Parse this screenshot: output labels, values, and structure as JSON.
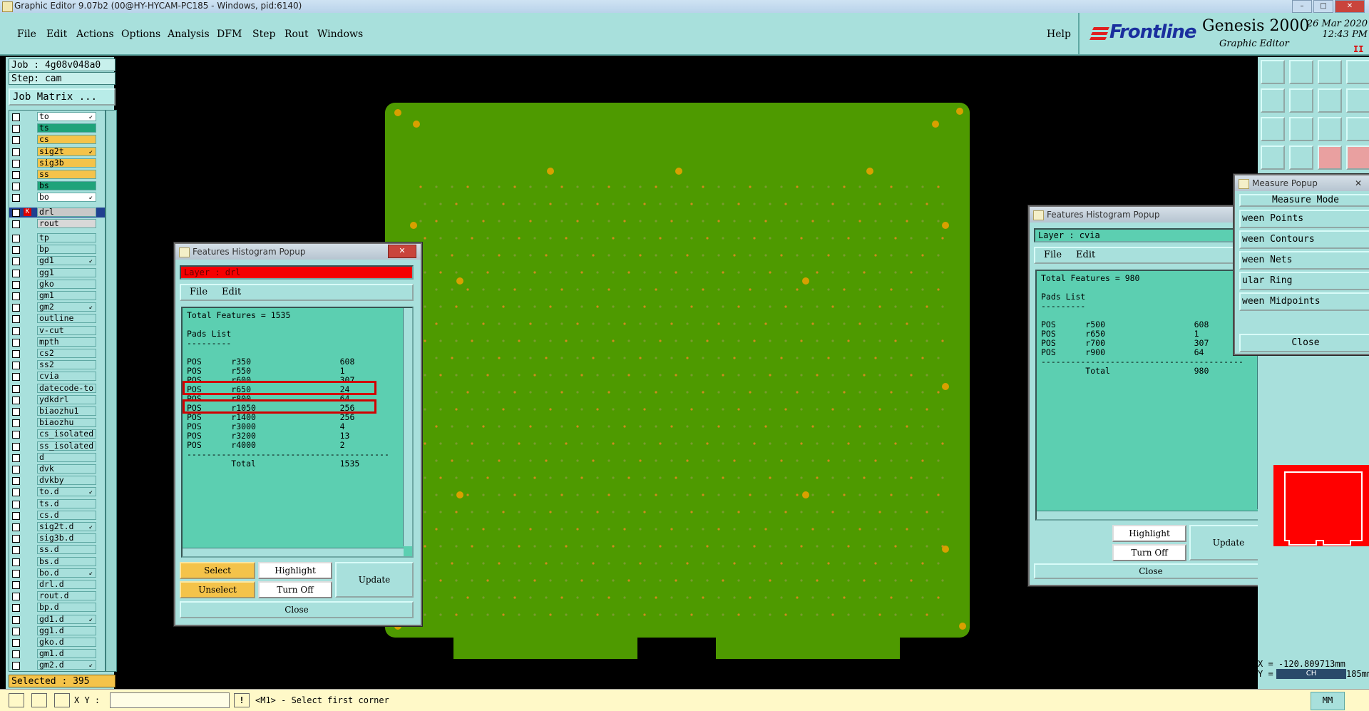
{
  "window": {
    "title": "Graphic Editor 9.07b2 (00@HY-HYCAM-PC185 - Windows, pid:6140)",
    "minimize": "–",
    "maximize": "□",
    "close": "✕"
  },
  "menu": {
    "items": [
      "File",
      "Edit",
      "Actions",
      "Options",
      "Analysis",
      "DFM",
      "Step",
      "Rout",
      "Windows"
    ],
    "help": "Help"
  },
  "brand": {
    "logo": "Frontline",
    "app": "Genesis 2000",
    "subtitle": "Graphic Editor",
    "date": "26 Mar 2020",
    "time": "12:43 PM",
    "pause": "II"
  },
  "left": {
    "job": "Job : 4g08v048a0",
    "step": "Step: cam",
    "job_matrix": "Job Matrix ...",
    "selected": "Selected : 395",
    "layers": [
      {
        "name": "to",
        "color": "#ffffff",
        "arrow": true
      },
      {
        "name": "ts",
        "color": "#1fa37a",
        "arrow": false
      },
      {
        "name": "cs",
        "color": "#f4c34a",
        "arrow": false
      },
      {
        "name": "sig2t",
        "color": "#f4c34a",
        "arrow": true
      },
      {
        "name": "sig3b",
        "color": "#f4c34a",
        "arrow": false
      },
      {
        "name": "ss",
        "color": "#f4c34a",
        "arrow": false
      },
      {
        "name": "bs",
        "color": "#1fa37a",
        "arrow": false
      },
      {
        "name": "bo",
        "color": "#ffffff",
        "arrow": true
      },
      {
        "name": "drl",
        "color": "#c8c8c8",
        "arrow": false,
        "active": true
      },
      {
        "name": "rout",
        "color": "#d8d8d8",
        "arrow": false
      },
      {
        "name": "tp",
        "color": "#a8e0dc",
        "arrow": false
      },
      {
        "name": "bp",
        "color": "#a8e0dc",
        "arrow": false
      },
      {
        "name": "gd1",
        "color": "#a8e0dc",
        "arrow": true
      },
      {
        "name": "gg1",
        "color": "#a8e0dc",
        "arrow": false
      },
      {
        "name": "gko",
        "color": "#a8e0dc",
        "arrow": false
      },
      {
        "name": "gm1",
        "color": "#a8e0dc",
        "arrow": false
      },
      {
        "name": "gm2",
        "color": "#a8e0dc",
        "arrow": true
      },
      {
        "name": "outline",
        "color": "#a8e0dc",
        "arrow": false
      },
      {
        "name": "v-cut",
        "color": "#a8e0dc",
        "arrow": false
      },
      {
        "name": "mpth",
        "color": "#a8e0dc",
        "arrow": false
      },
      {
        "name": "cs2",
        "color": "#a8e0dc",
        "arrow": false
      },
      {
        "name": "ss2",
        "color": "#a8e0dc",
        "arrow": false
      },
      {
        "name": "cvia",
        "color": "#a8e0dc",
        "arrow": false
      },
      {
        "name": "datecode-to",
        "color": "#a8e0dc",
        "arrow": false
      },
      {
        "name": "ydkdrl",
        "color": "#a8e0dc",
        "arrow": false
      },
      {
        "name": "biaozhu1",
        "color": "#a8e0dc",
        "arrow": false
      },
      {
        "name": "biaozhu",
        "color": "#a8e0dc",
        "arrow": false
      },
      {
        "name": "cs_isolated",
        "color": "#a8e0dc",
        "arrow": false
      },
      {
        "name": "ss_isolated",
        "color": "#a8e0dc",
        "arrow": false
      },
      {
        "name": "d",
        "color": "#a8e0dc",
        "arrow": false
      },
      {
        "name": "dvk",
        "color": "#a8e0dc",
        "arrow": false
      },
      {
        "name": "dvkby",
        "color": "#a8e0dc",
        "arrow": false
      },
      {
        "name": "to.d",
        "color": "#a8e0dc",
        "arrow": true
      },
      {
        "name": "ts.d",
        "color": "#a8e0dc",
        "arrow": false
      },
      {
        "name": "cs.d",
        "color": "#a8e0dc",
        "arrow": false
      },
      {
        "name": "sig2t.d",
        "color": "#a8e0dc",
        "arrow": true
      },
      {
        "name": "sig3b.d",
        "color": "#a8e0dc",
        "arrow": false
      },
      {
        "name": "ss.d",
        "color": "#a8e0dc",
        "arrow": false
      },
      {
        "name": "bs.d",
        "color": "#a8e0dc",
        "arrow": false
      },
      {
        "name": "bo.d",
        "color": "#a8e0dc",
        "arrow": true
      },
      {
        "name": "drl.d",
        "color": "#a8e0dc",
        "arrow": false
      },
      {
        "name": "rout.d",
        "color": "#a8e0dc",
        "arrow": false
      },
      {
        "name": "bp.d",
        "color": "#a8e0dc",
        "arrow": false
      },
      {
        "name": "gd1.d",
        "color": "#a8e0dc",
        "arrow": true
      },
      {
        "name": "gg1.d",
        "color": "#a8e0dc",
        "arrow": false
      },
      {
        "name": "gko.d",
        "color": "#a8e0dc",
        "arrow": false
      },
      {
        "name": "gm1.d",
        "color": "#a8e0dc",
        "arrow": false
      },
      {
        "name": "gm2.d",
        "color": "#a8e0dc",
        "arrow": true
      }
    ]
  },
  "histo_left": {
    "title": "Features Histogram Popup",
    "close": "✕",
    "layer": "Layer :  drl",
    "menu": [
      "File",
      "Edit"
    ],
    "lines": [
      "Total Features = 1535",
      "",
      "Pads List",
      "---------",
      "",
      "POS      r350                  608",
      "POS      r550                  1",
      "POS      r600                  307",
      "POS      r650                  24",
      "POS      r800                  64",
      "POS      r1050                 256",
      "POS      r1400                 256",
      "POS      r3000                 4",
      "POS      r3200                 13",
      "POS      r4000                 2",
      "-----------------------------------------",
      "         Total                 1535"
    ],
    "buttons": {
      "select": "Select",
      "unselect": "Unselect",
      "highlight": "Highlight",
      "turn_off": "Turn Off",
      "update": "Update",
      "close": "Close"
    }
  },
  "histo_right": {
    "title": "Features Histogram Popup",
    "close": "✕",
    "layer": "Layer :  cvia",
    "menu": [
      "File",
      "Edit"
    ],
    "lines": [
      "Total Features = 980",
      "",
      "Pads List",
      "---------",
      "",
      "POS      r500                  608",
      "POS      r650                  1",
      "POS      r700                  307",
      "POS      r900                  64",
      "-----------------------------------------",
      "         Total                 980"
    ],
    "buttons": {
      "highlight": "Highlight",
      "turn_off": "Turn Off",
      "update": "Update",
      "close": "Close"
    }
  },
  "measure": {
    "title": "Measure Popup",
    "close": "✕",
    "mode": "Measure Mode",
    "items": [
      "ween Points",
      "ween Contours",
      "ween Nets",
      "ular Ring",
      "ween Midpoints"
    ],
    "close_btn": "Close"
  },
  "coords": {
    "x": "X = -120.809713mm",
    "y": "Y = ",
    "y_tail": "185mm"
  },
  "ime": {
    "label": "CH"
  },
  "status": {
    "xy_label": "X Y :",
    "xy_value": "",
    "message": "<M1> - Select first corner",
    "units": "MM"
  }
}
